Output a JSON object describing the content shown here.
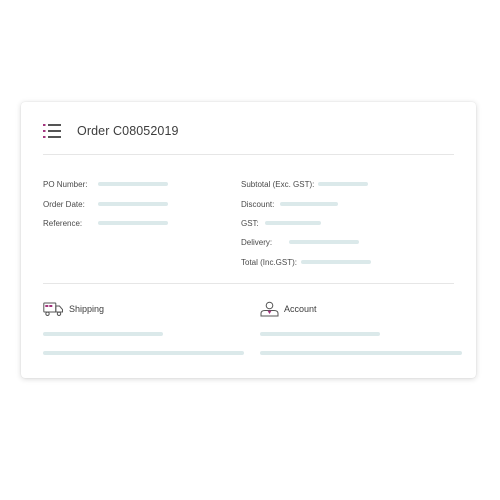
{
  "order": {
    "title": "Order C08052019",
    "icon": "list-icon"
  },
  "left_fields": [
    {
      "label": "PO Number:"
    },
    {
      "label": "Order Date:"
    },
    {
      "label": "Reference:"
    }
  ],
  "right_fields": [
    {
      "label": "Subtotal (Exc. GST):"
    },
    {
      "label": "Discount:"
    },
    {
      "label": "GST:"
    },
    {
      "label": "Delivery:"
    },
    {
      "label": "Total (Inc.GST):"
    }
  ],
  "sections": {
    "shipping": {
      "label": "Shipping",
      "icon": "delivery-truck-icon"
    },
    "account": {
      "label": "Account",
      "icon": "user-account-icon"
    }
  },
  "colors": {
    "accent": "#a3357e",
    "placeholder_bar": "#dbe9ea",
    "icon_stroke": "#555555"
  }
}
